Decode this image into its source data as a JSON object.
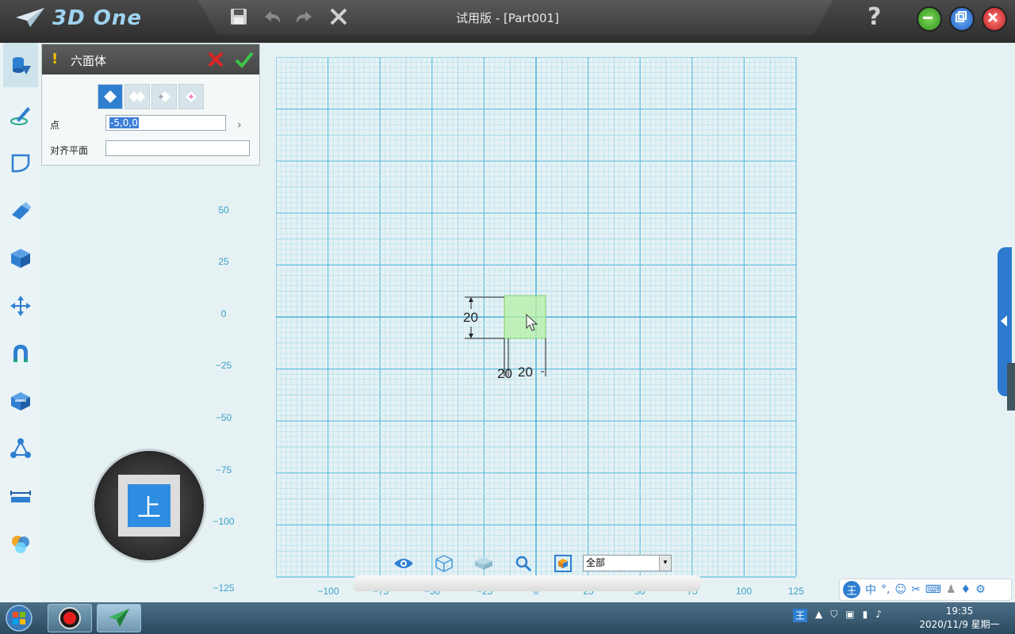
{
  "app": {
    "logo_text": "3D One",
    "window_title": "试用版 - [Part001]",
    "help_label": "?"
  },
  "panel": {
    "title": "六面体",
    "warning": "!",
    "point_label": "点",
    "point_value": "-5,0,0",
    "align_label": "对齐平面",
    "align_value": ""
  },
  "viewcube": {
    "face_label": "上"
  },
  "axes": {
    "y_ticks": [
      "50",
      "25",
      "0",
      "−25",
      "−50",
      "−75",
      "−100",
      "−125"
    ],
    "x_ticks": [
      "−100",
      "−75",
      "−50",
      "−25",
      "0",
      "25",
      "50",
      "75",
      "100",
      "125"
    ]
  },
  "dimensions": {
    "height": "20",
    "width_a": "20",
    "width_b": "20"
  },
  "bottom_toolbar": {
    "filter_value": "全部"
  },
  "ime": {
    "mode": "中"
  },
  "taskbar": {
    "time": "19:35",
    "date": "2020/11/9 星期一"
  },
  "colors": {
    "accent": "#2f7fd1",
    "grid": "#8fd3ea",
    "preview_box": "#b6f0a6"
  }
}
